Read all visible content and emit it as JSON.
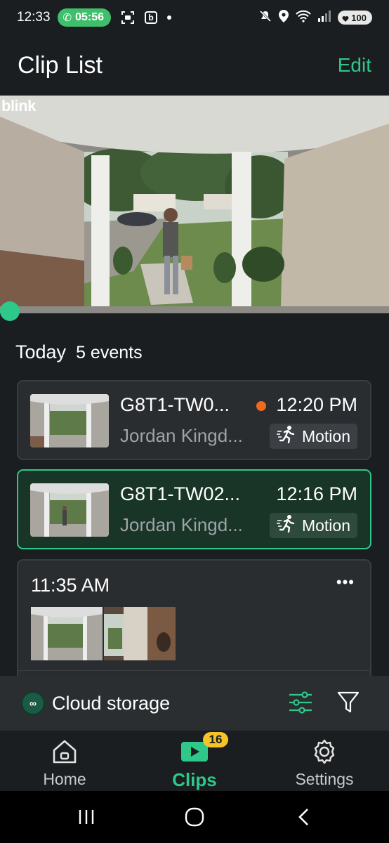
{
  "status_bar": {
    "time": "12:33",
    "call_duration": "05:56",
    "battery": "100",
    "icons": [
      "phone-icon",
      "screenshot-icon",
      "b-app-icon",
      "dot-icon",
      "mute-icon",
      "location-icon",
      "wifi-icon",
      "signal-icon",
      "battery-icon"
    ]
  },
  "header": {
    "title": "Clip List",
    "edit_label": "Edit"
  },
  "video": {
    "watermark": "blink"
  },
  "today": {
    "label": "Today",
    "count": "5 events"
  },
  "events": [
    {
      "name": "G8T1-TW0...",
      "time": "12:20 PM",
      "location": "Jordan Kingd...",
      "tag": "Motion",
      "unviewed": true,
      "selected": false
    },
    {
      "name": "G8T1-TW02...",
      "time": "12:16 PM",
      "location": "Jordan Kingd...",
      "tag": "Motion",
      "unviewed": false,
      "selected": true
    }
  ],
  "group": {
    "time": "11:35 AM",
    "more": "•••"
  },
  "cloud": {
    "label": "Cloud storage",
    "icon_text": "∞"
  },
  "nav": {
    "home": "Home",
    "clips": "Clips",
    "clips_badge": "16",
    "settings": "Settings"
  },
  "colors": {
    "accent": "#2ec98a",
    "unviewed_dot": "#ee6a1c",
    "badge": "#f5c427",
    "background": "#1b1e20",
    "card": "#2a2d30"
  }
}
